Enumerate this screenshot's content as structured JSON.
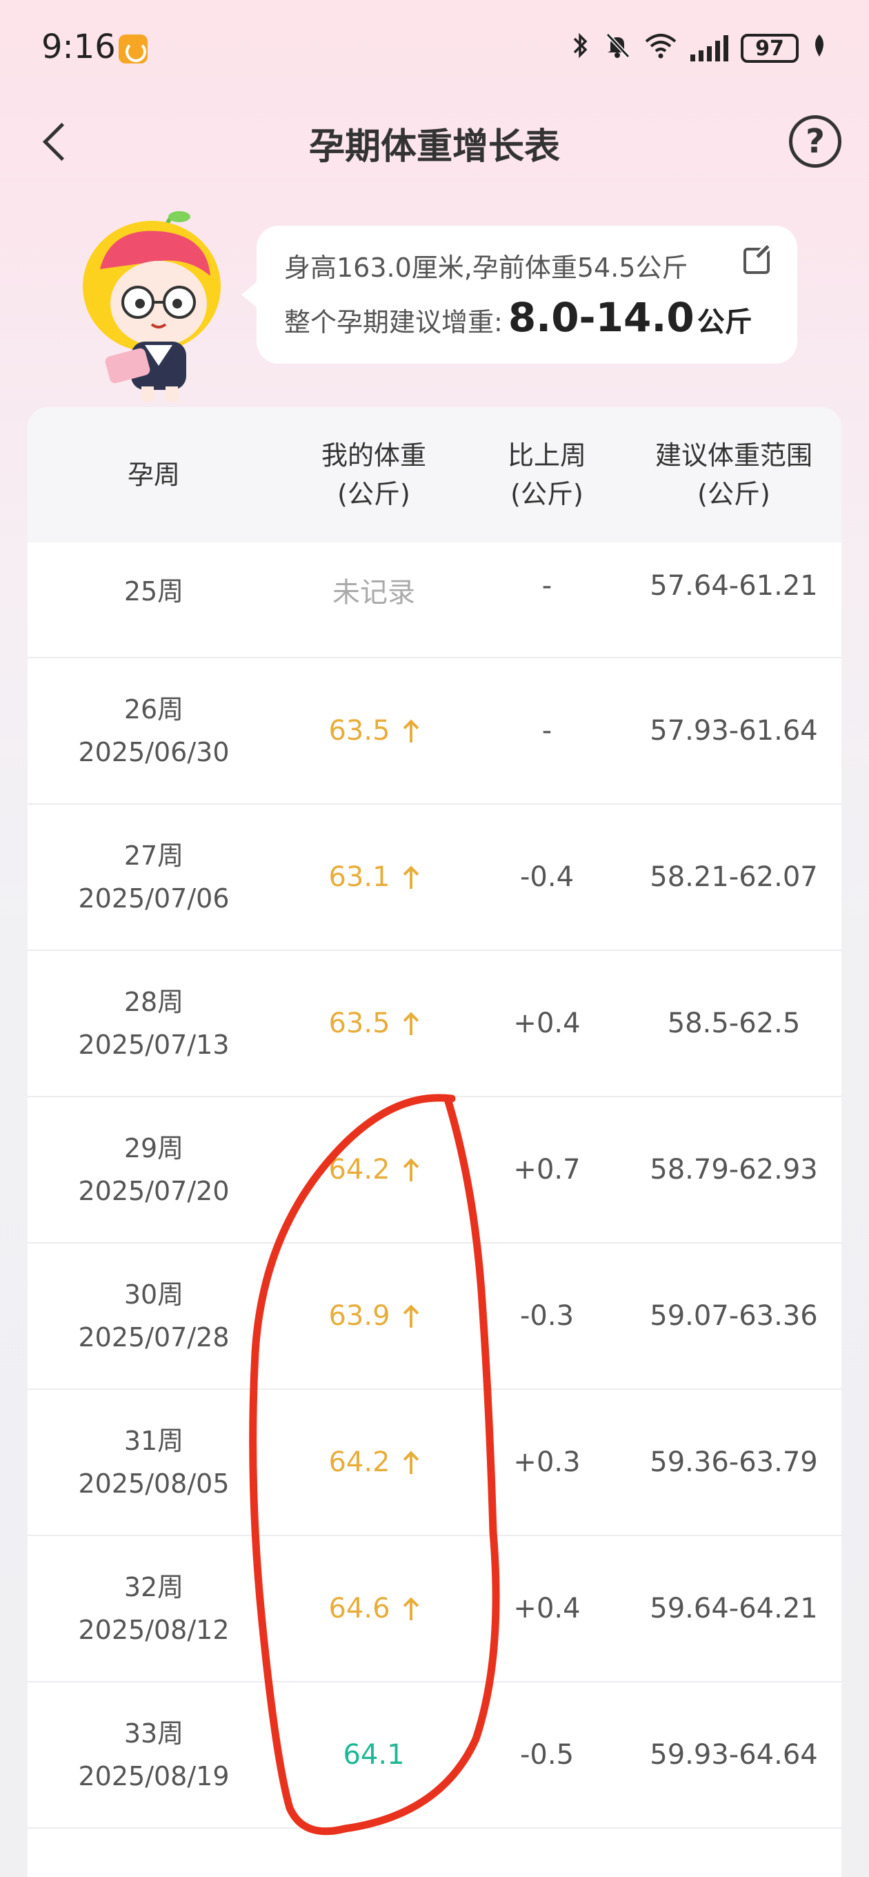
{
  "status_bar": {
    "time": "9:16",
    "battery": "97",
    "icons": [
      "bluetooth-icon",
      "mute-icon",
      "wifi-icon",
      "signal-icon",
      "battery-icon",
      "leaf-icon"
    ]
  },
  "header": {
    "title": "孕期体重增长表",
    "back_icon": "chevron-left-icon",
    "help_icon": "question-circle-icon",
    "help_glyph": "?"
  },
  "info": {
    "line1": "身高163.0厘米,孕前体重54.5公斤",
    "line2_label": "整个孕期建议增重:",
    "gain_range": "8.0-14.0",
    "gain_unit": "公斤"
  },
  "table": {
    "headers": [
      {
        "line1": "孕周",
        "line2": ""
      },
      {
        "line1": "我的体重",
        "line2": "(公斤)"
      },
      {
        "line1": "比上周",
        "line2": "(公斤)"
      },
      {
        "line1": "建议体重范围",
        "line2": "(公斤)"
      }
    ],
    "rows": [
      {
        "week": "25周",
        "date": "",
        "weight": "未记录",
        "status": "none",
        "change": "-",
        "range": "57.64-61.21"
      },
      {
        "week": "26周",
        "date": "2025/06/30",
        "weight": "63.5",
        "status": "up",
        "change": "-",
        "range": "57.93-61.64"
      },
      {
        "week": "27周",
        "date": "2025/07/06",
        "weight": "63.1",
        "status": "up",
        "change": "-0.4",
        "range": "58.21-62.07"
      },
      {
        "week": "28周",
        "date": "2025/07/13",
        "weight": "63.5",
        "status": "up",
        "change": "+0.4",
        "range": "58.5-62.5"
      },
      {
        "week": "29周",
        "date": "2025/07/20",
        "weight": "64.2",
        "status": "up",
        "change": "+0.7",
        "range": "58.79-62.93"
      },
      {
        "week": "30周",
        "date": "2025/07/28",
        "weight": "63.9",
        "status": "up",
        "change": "-0.3",
        "range": "59.07-63.36"
      },
      {
        "week": "31周",
        "date": "2025/08/05",
        "weight": "64.2",
        "status": "up",
        "change": "+0.3",
        "range": "59.36-63.79"
      },
      {
        "week": "32周",
        "date": "2025/08/12",
        "weight": "64.6",
        "status": "up",
        "change": "+0.4",
        "range": "59.64-64.21"
      },
      {
        "week": "33周",
        "date": "2025/08/19",
        "weight": "64.1",
        "status": "norm",
        "change": "-0.5",
        "range": "59.93-64.64"
      }
    ]
  },
  "colors": {
    "above_range": "#e8ad3a",
    "in_range": "#1eb896",
    "not_recorded": "#aaaaaa",
    "annotation": "#e8321e"
  }
}
